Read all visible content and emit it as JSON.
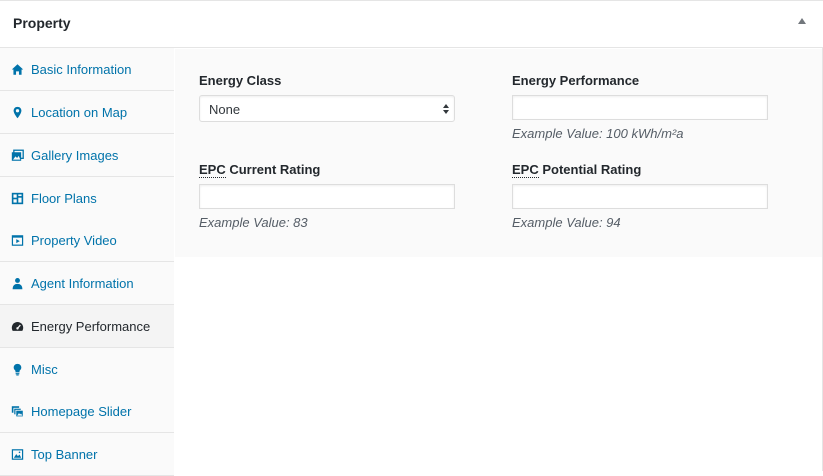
{
  "metabox": {
    "title": "Property",
    "toggle_icon": "triangle-up-icon"
  },
  "sidebar": {
    "tabs": [
      {
        "label": "Basic Information",
        "icon": "home-icon",
        "active": false
      },
      {
        "label": "Location on Map",
        "icon": "map-pin-icon",
        "active": false
      },
      {
        "label": "Gallery Images",
        "icon": "gallery-icon",
        "active": false
      },
      {
        "label": "Floor Plans",
        "icon": "floor-plan-icon",
        "active": false
      },
      {
        "label": "Property Video",
        "icon": "video-icon",
        "active": false
      },
      {
        "label": "Agent Information",
        "icon": "agent-icon",
        "active": false
      },
      {
        "label": "Energy Performance",
        "icon": "dashboard-icon",
        "active": true
      },
      {
        "label": "Misc",
        "icon": "lightbulb-icon",
        "active": false
      },
      {
        "label": "Homepage Slider",
        "icon": "slider-icon",
        "active": false
      },
      {
        "label": "Top Banner",
        "icon": "banner-image-icon",
        "active": false
      }
    ]
  },
  "energy": {
    "energy_class": {
      "label": "Energy Class",
      "value": "None"
    },
    "energy_performance": {
      "label": "Energy Performance",
      "value": "",
      "hint": "Example Value: 100 kWh/m²a"
    },
    "epc_current": {
      "label_abbr": "EPC",
      "label_rest": " Current Rating",
      "value": "",
      "hint": "Example Value: 83"
    },
    "epc_potential": {
      "label_abbr": "EPC",
      "label_rest": " Potential Rating",
      "value": "",
      "hint": "Example Value: 94"
    }
  },
  "colors": {
    "link": "#0073aa",
    "text": "#23282d",
    "icon": "#0073aa",
    "active_icon": "#23282d",
    "border": "#e5e5e5"
  }
}
